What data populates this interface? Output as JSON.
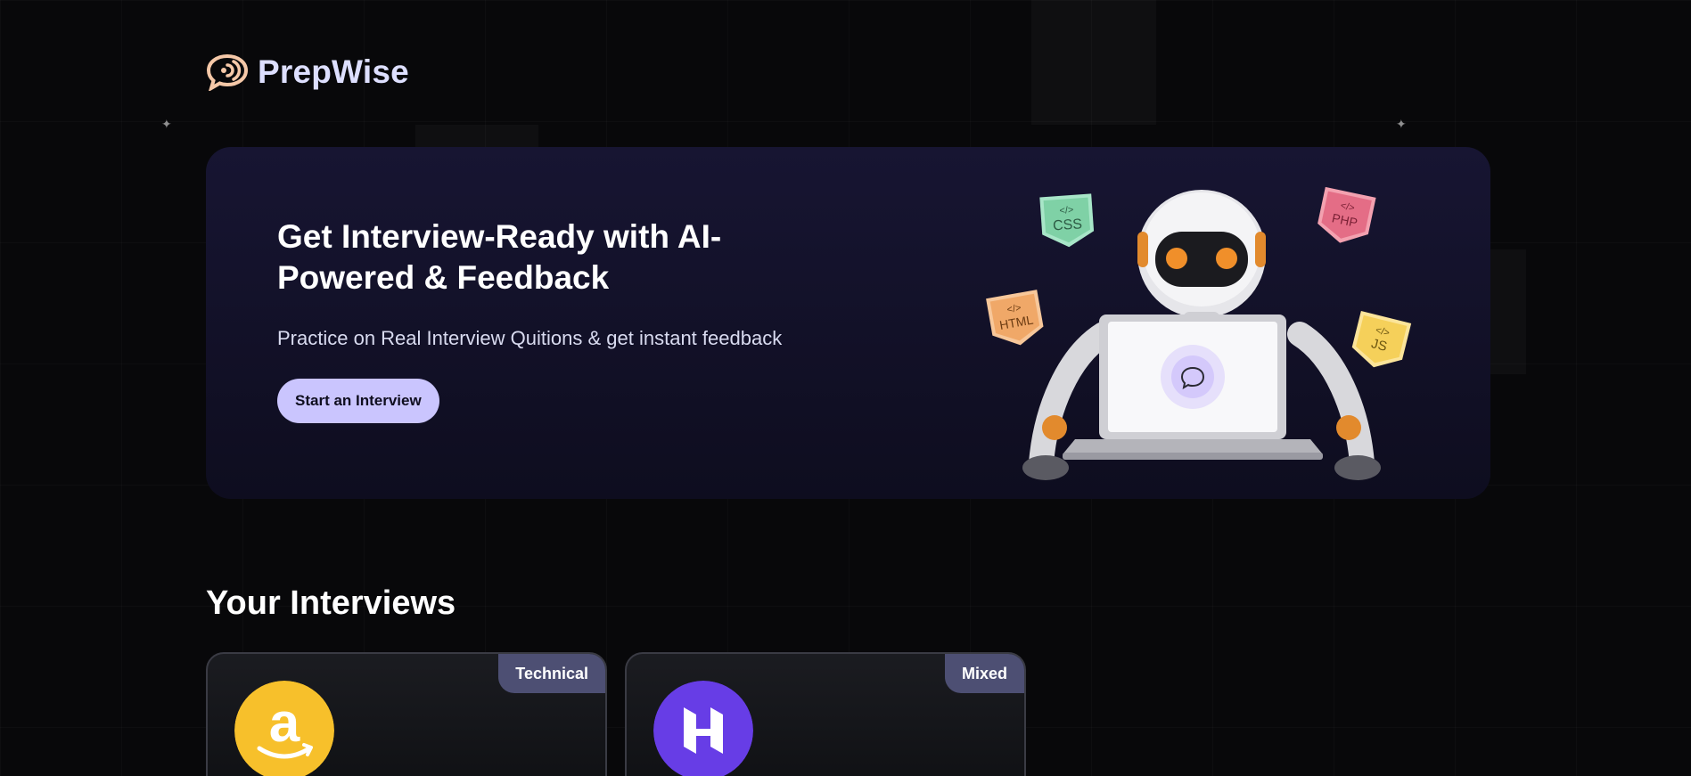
{
  "brand": {
    "name": "PrepWise",
    "logo_icon": "chat-bubble-icon",
    "color": "#dddfff",
    "logo_color": "#f5c8a8"
  },
  "hero": {
    "title": "Get Interview-Ready with AI-Powered & Feedback",
    "subtitle": "Practice on Real Interview Quitions & get instant feedback",
    "cta_label": "Start an Interview",
    "badges": [
      "CSS",
      "PHP",
      "HTML",
      "JS"
    ],
    "colors": {
      "card_bg": "#171532",
      "cta_bg": "#cac5fe"
    }
  },
  "interviews": {
    "title": "Your Interviews",
    "cards": [
      {
        "type": "Technical",
        "company_icon": "amazon-icon",
        "logo_color": "#f7c02b"
      },
      {
        "type": "Mixed",
        "company_icon": "hostinger-icon",
        "logo_color": "#673de6"
      }
    ]
  }
}
